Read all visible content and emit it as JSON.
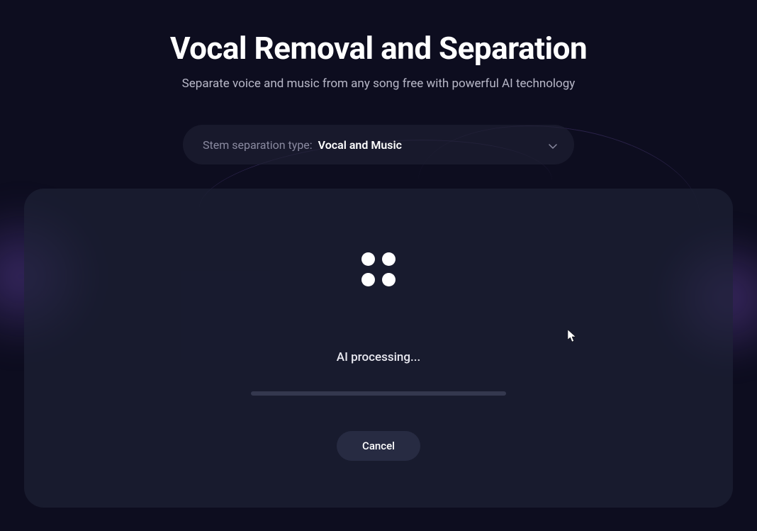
{
  "header": {
    "title": "Vocal Removal and Separation",
    "subtitle": "Separate voice and music from any song free with powerful AI technology"
  },
  "dropdown": {
    "label": "Stem separation type:",
    "value": "Vocal and Music"
  },
  "processing": {
    "status": "AI processing...",
    "cancel_label": "Cancel"
  }
}
